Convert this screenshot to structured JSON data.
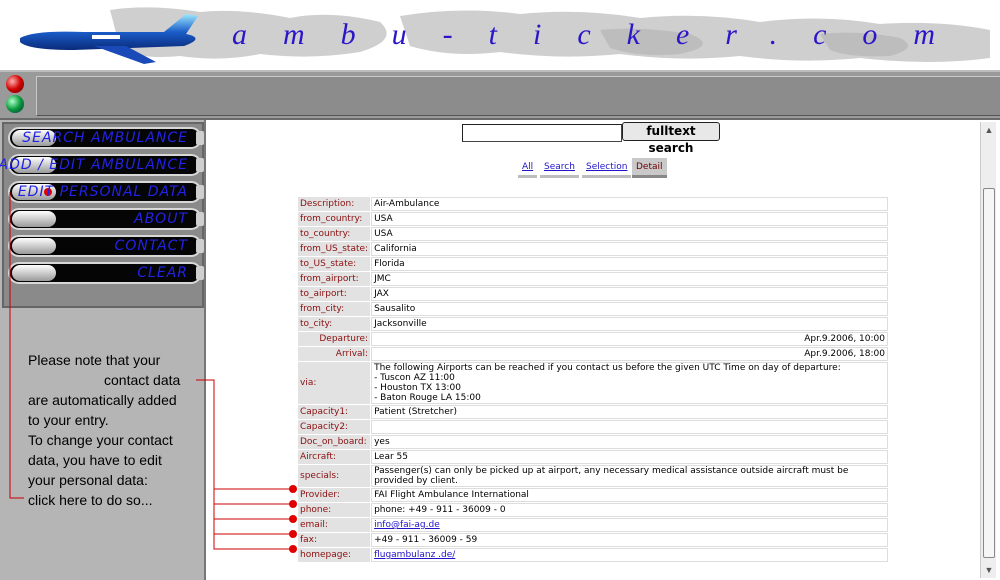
{
  "header": {
    "title": "ambu-ticker.com"
  },
  "nav": {
    "items": [
      {
        "label": "SEARCH AMBULANCE"
      },
      {
        "label": "ADD / EDIT AMBULANCE"
      },
      {
        "label": "EDIT PERSONAL DATA"
      },
      {
        "label": "ABOUT"
      },
      {
        "label": "CONTACT"
      },
      {
        "label": "CLEAR"
      }
    ]
  },
  "note": {
    "line1": "Please note that your",
    "line2": "contact data",
    "line3": "are automatically added",
    "line4": "to your entry.",
    "line5": "To change your contact",
    "line6": "data, you have to edit",
    "line7": "your personal data:",
    "line8": "click here to do so..."
  },
  "search": {
    "value": "",
    "button_label": "fulltext search"
  },
  "tabs": {
    "all": "All",
    "search": "Search",
    "selection": "Selection",
    "detail": "Detail"
  },
  "details": {
    "description": {
      "key": "Description:",
      "value": "Air-Ambulance"
    },
    "from_country": {
      "key": "from_country:",
      "value": "USA"
    },
    "to_country": {
      "key": "to_country:",
      "value": "USA"
    },
    "from_us_state": {
      "key": "from_US_state:",
      "value": "California"
    },
    "to_us_state": {
      "key": "to_US_state:",
      "value": "Florida"
    },
    "from_airport": {
      "key": "from_airport:",
      "value": "JMC"
    },
    "to_airport": {
      "key": "to_airport:",
      "value": "JAX"
    },
    "from_city": {
      "key": "from_city:",
      "value": "Sausalito"
    },
    "to_city": {
      "key": "to_city:",
      "value": "Jacksonville"
    },
    "departure": {
      "key": "Departure:",
      "value": "Apr.9.2006, 10:00"
    },
    "arrival": {
      "key": "Arrival:",
      "value": "Apr.9.2006, 18:00"
    },
    "via": {
      "key": "via:",
      "line1": "The following Airports can be reached if you contact us before the given UTC Time on day of departure:",
      "line2": "- Tuscon AZ 11:00",
      "line3": "- Houston TX 13:00",
      "line4": "- Baton Rouge LA 15:00"
    },
    "capacity1": {
      "key": "Capacity1:",
      "value": "Patient (Stretcher)"
    },
    "capacity2": {
      "key": "Capacity2:",
      "value": ""
    },
    "doc_on_board": {
      "key": "Doc_on_board:",
      "value": "yes"
    },
    "aircraft": {
      "key": "Aircraft:",
      "value": "Lear 55"
    },
    "specials": {
      "key": "specials:",
      "value": "Passenger(s) can only be picked up at airport, any necessary medical assistance outside aircraft must be provided by client."
    },
    "provider": {
      "key": "Provider:",
      "value": "FAI Flight Ambulance International"
    },
    "phone": {
      "key": "phone:",
      "value": "phone: +49 - 911 - 36009 - 0"
    },
    "email": {
      "key": "email:",
      "value": "info@fai-ag.de"
    },
    "fax": {
      "key": "fax:",
      "value": "+49 - 911 - 36009 - 59"
    },
    "homepage": {
      "key": "homepage:",
      "value": "flugambulanz .de/"
    }
  },
  "colors": {
    "title_blue": "#2a16c8",
    "key_red": "#8b0f0f",
    "link_blue": "#2214c8",
    "marker_red": "#e00000"
  }
}
